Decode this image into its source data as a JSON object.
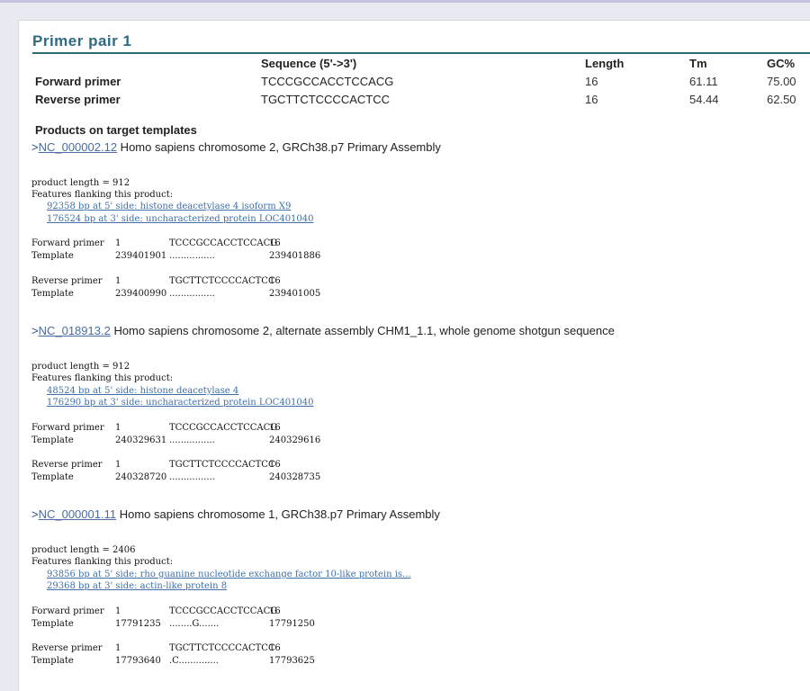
{
  "title": "Primer pair 1",
  "primer_table": {
    "headers": [
      "",
      "Sequence (5'->3')",
      "Length",
      "Tm",
      "GC%"
    ],
    "rows": [
      {
        "label": "Forward primer",
        "sequence": "TCCCGCCACCTCCACG",
        "length": "16",
        "tm": "61.11",
        "gc": "75.00"
      },
      {
        "label": "Reverse primer",
        "sequence": "TGCTTCTCCCCACTCC",
        "length": "16",
        "tm": "54.44",
        "gc": "62.50"
      }
    ]
  },
  "products_heading": "Products on target templates",
  "products": [
    {
      "prefix": ">",
      "accession": "NC_000002.12",
      "description": " Homo sapiens chromosome 2, GRCh38.p7 Primary Assembly",
      "length_line": "product length = 912",
      "features_label": "Features flanking this product:",
      "features": [
        "92358 bp at 5' side: histone deacetylase 4 isoform X9",
        "176524 bp at 3' side: uncharacterized protein LOC401040"
      ],
      "fwd": {
        "label": "Forward primer",
        "start": "1",
        "seq": "TCCCGCCACCTCCACG",
        "end": "16"
      },
      "fwd_tmpl": {
        "label": "Template",
        "start": "239401901",
        "seq": "................",
        "end": "239401886"
      },
      "rev": {
        "label": "Reverse primer",
        "start": "1",
        "seq": "TGCTTCTCCCCACTCC",
        "end": "16"
      },
      "rev_tmpl": {
        "label": "Template",
        "start": "239400990",
        "seq": "................",
        "end": "239401005"
      }
    },
    {
      "prefix": ">",
      "accession": "NC_018913.2",
      "description": " Homo sapiens chromosome 2, alternate assembly CHM1_1.1, whole genome shotgun sequence",
      "length_line": "product length = 912",
      "features_label": "Features flanking this product:",
      "features": [
        "48524 bp at 5' side: histone deacetylase 4",
        "176290 bp at 3' side: uncharacterized protein LOC401040"
      ],
      "fwd": {
        "label": "Forward primer",
        "start": "1",
        "seq": "TCCCGCCACCTCCACG",
        "end": "16"
      },
      "fwd_tmpl": {
        "label": "Template",
        "start": "240329631",
        "seq": "................",
        "end": "240329616"
      },
      "rev": {
        "label": "Reverse primer",
        "start": "1",
        "seq": "TGCTTCTCCCCACTCC",
        "end": "16"
      },
      "rev_tmpl": {
        "label": "Template",
        "start": "240328720",
        "seq": "................",
        "end": "240328735"
      }
    },
    {
      "prefix": ">",
      "accession": "NC_000001.11",
      "description": " Homo sapiens chromosome 1, GRCh38.p7 Primary Assembly",
      "length_line": "product length = 2406",
      "features_label": "Features flanking this product:",
      "features": [
        "93856 bp at 5' side: rho guanine nucleotide exchange factor 10-like protein is...",
        "29368 bp at 3' side: actin-like protein 8"
      ],
      "fwd": {
        "label": "Forward primer",
        "start": "1",
        "seq": "TCCCGCCACCTCCACG",
        "end": "16"
      },
      "fwd_tmpl": {
        "label": "Template",
        "start": "17791235",
        "seq": "........G.......",
        "end": "17791250"
      },
      "rev": {
        "label": "Reverse primer",
        "start": "1",
        "seq": "TGCTTCTCCCCACTCC",
        "end": "16"
      },
      "rev_tmpl": {
        "label": "Template",
        "start": "17793640",
        "seq": ".C..............",
        "end": "17793625"
      }
    }
  ]
}
